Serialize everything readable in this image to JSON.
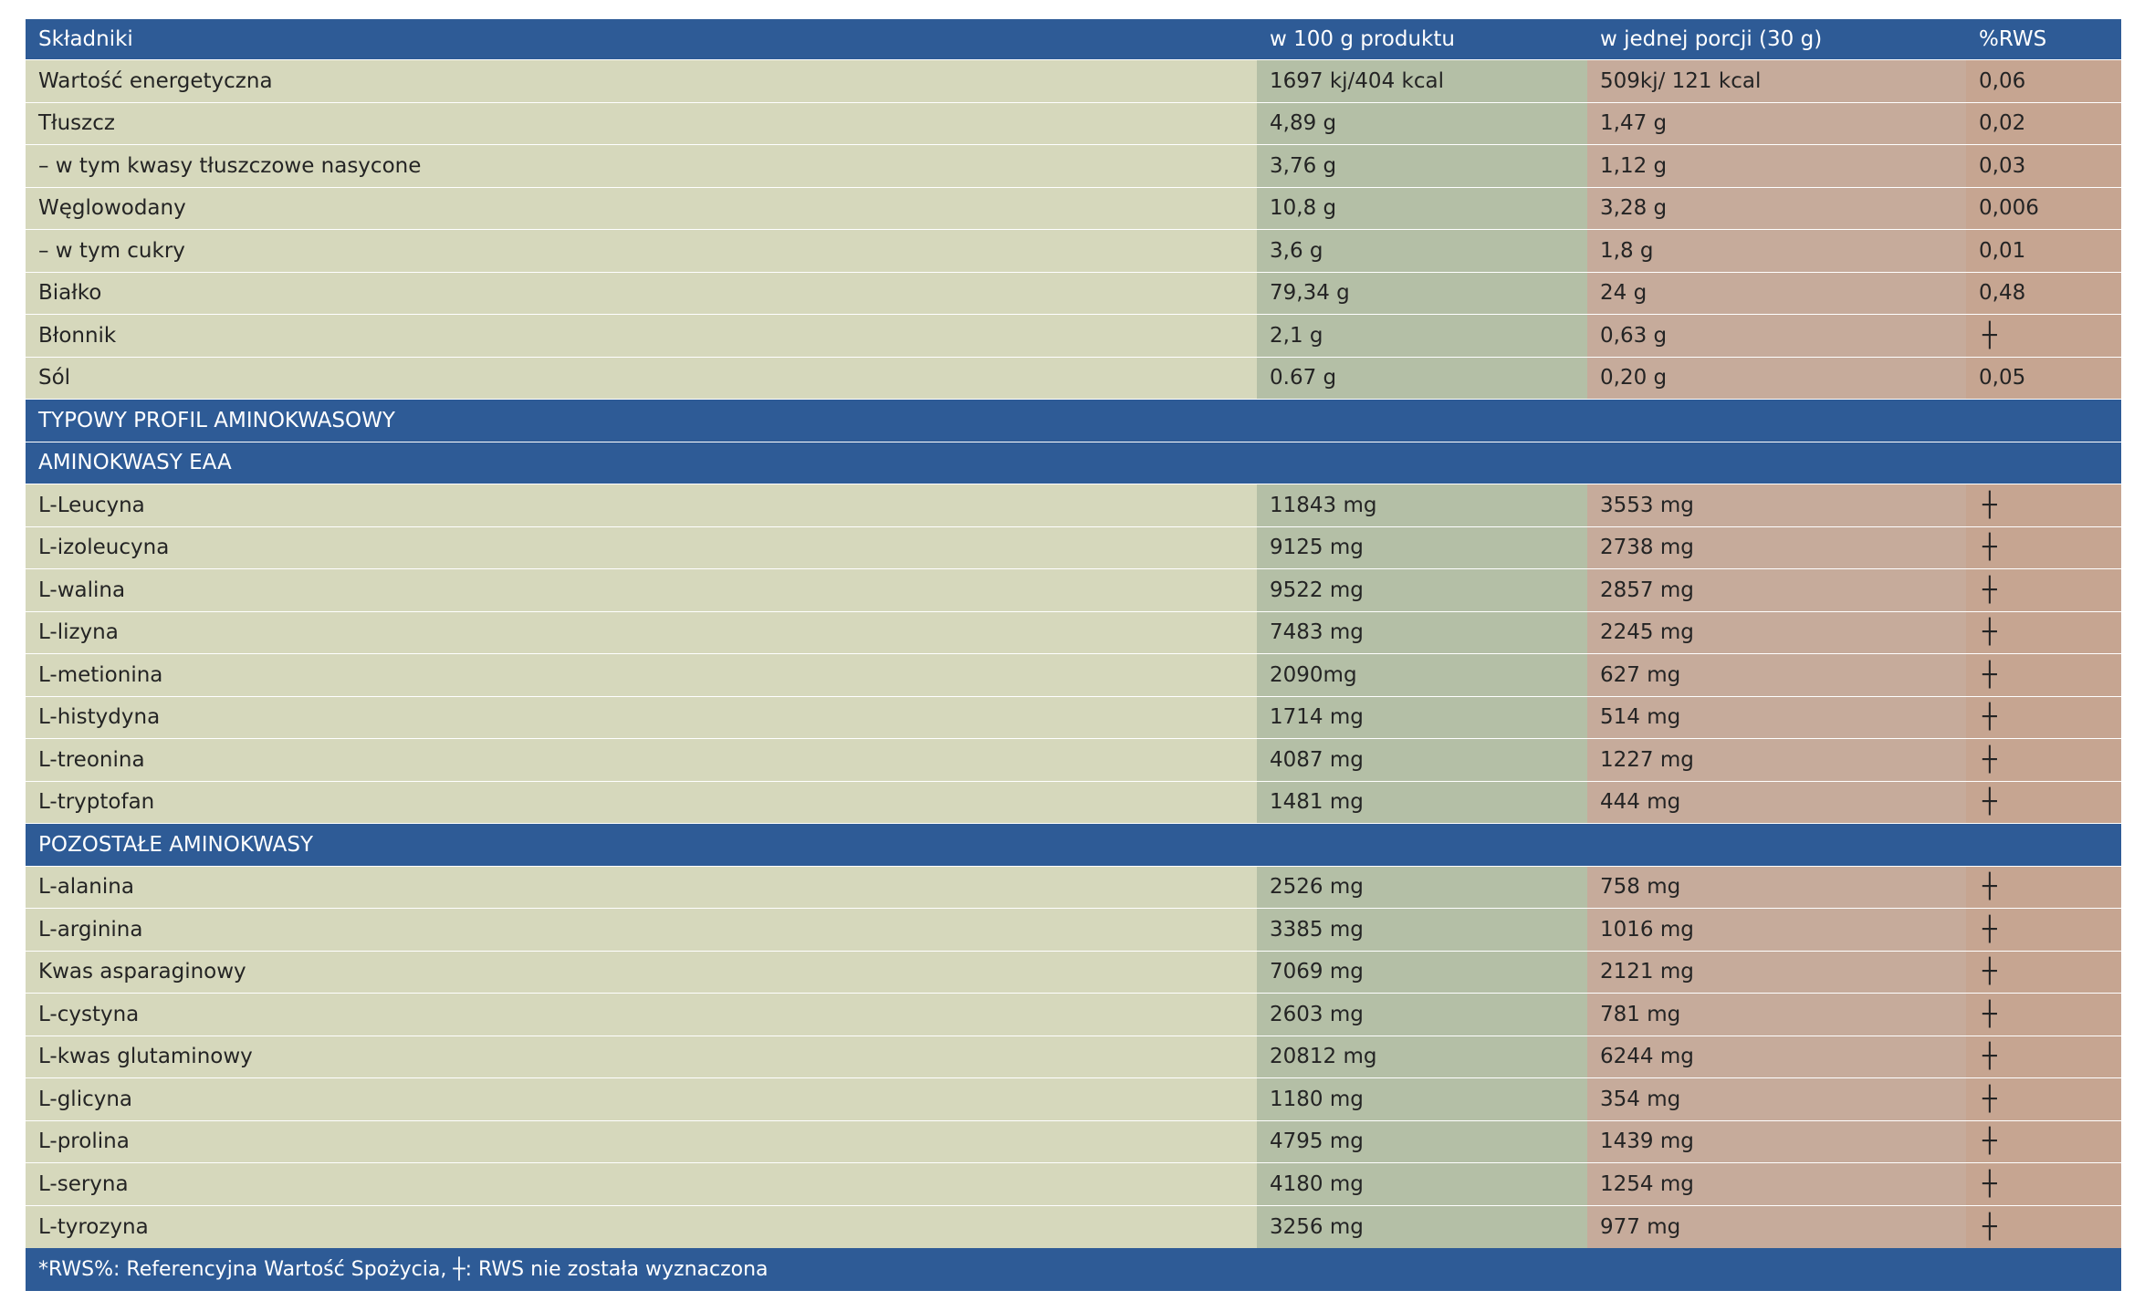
{
  "colors": {
    "header_blue": "#2e5b96",
    "col1_bg": "#d6d8bc",
    "col2_bg": "#b4bfa6",
    "col3_bg": "#c6ab9b",
    "col4_bg": "#c6a591"
  },
  "table": {
    "header": [
      "Składniki",
      "w 100 g produktu",
      "w jednej porcji (30 g)",
      "%RWS"
    ],
    "rows": [
      {
        "type": "data",
        "cells": [
          "Wartość energetyczna",
          "1697 kj/404 kcal",
          "509kj/ 121 kcal",
          "0,06"
        ]
      },
      {
        "type": "data",
        "cells": [
          "Tłuszcz",
          "4,89 g",
          "1,47 g",
          "0,02"
        ]
      },
      {
        "type": "data",
        "cells": [
          "– w tym kwasy tłuszczowe nasycone",
          "3,76 g",
          "1,12 g",
          "0,03"
        ]
      },
      {
        "type": "data",
        "cells": [
          "Węglowodany",
          "10,8 g",
          "3,28 g",
          "0,006"
        ]
      },
      {
        "type": "data",
        "cells": [
          "– w tym cukry",
          "3,6 g",
          "1,8 g",
          "0,01"
        ]
      },
      {
        "type": "data",
        "cells": [
          "Białko",
          "79,34 g",
          "24 g",
          "0,48"
        ]
      },
      {
        "type": "data",
        "cells": [
          "Błonnik",
          "2,1 g",
          "0,63 g",
          "┼"
        ]
      },
      {
        "type": "data",
        "cells": [
          "Sól",
          "0.67 g",
          "0,20 g",
          "0,05"
        ]
      },
      {
        "type": "section",
        "label": "TYPOWY PROFIL AMINOKWASOWY"
      },
      {
        "type": "section",
        "label": "AMINOKWASY EAA"
      },
      {
        "type": "data",
        "cells": [
          "L-Leucyna",
          "11843 mg",
          "3553 mg",
          "┼"
        ]
      },
      {
        "type": "data",
        "cells": [
          "L-izoleucyna",
          "9125 mg",
          "2738 mg",
          "┼"
        ]
      },
      {
        "type": "data",
        "cells": [
          "L-walina",
          "9522 mg",
          "2857 mg",
          "┼"
        ]
      },
      {
        "type": "data",
        "cells": [
          "L-lizyna",
          "7483 mg",
          "2245 mg",
          "┼"
        ]
      },
      {
        "type": "data",
        "cells": [
          "L-metionina",
          "2090mg",
          "627 mg",
          "┼"
        ]
      },
      {
        "type": "data",
        "cells": [
          "L-histydyna",
          "1714 mg",
          "514 mg",
          "┼"
        ]
      },
      {
        "type": "data",
        "cells": [
          "L-treonina",
          "4087 mg",
          "1227 mg",
          "┼"
        ]
      },
      {
        "type": "data",
        "cells": [
          "L-tryptofan",
          "1481 mg",
          "444 mg",
          "┼"
        ]
      },
      {
        "type": "section",
        "label": "POZOSTAŁE AMINOKWASY"
      },
      {
        "type": "data",
        "cells": [
          "L-alanina",
          "2526 mg",
          "758 mg",
          "┼"
        ]
      },
      {
        "type": "data",
        "cells": [
          "L-arginina",
          "3385 mg",
          "1016 mg",
          "┼"
        ]
      },
      {
        "type": "data",
        "cells": [
          "Kwas asparaginowy",
          "7069 mg",
          "2121 mg",
          "┼"
        ]
      },
      {
        "type": "data",
        "cells": [
          "L-cystyna",
          "2603 mg",
          "781 mg",
          "┼"
        ]
      },
      {
        "type": "data",
        "cells": [
          "L-kwas glutaminowy",
          "20812 mg",
          "6244 mg",
          "┼"
        ]
      },
      {
        "type": "data",
        "cells": [
          "L-glicyna",
          "1180 mg",
          "354 mg",
          "┼"
        ]
      },
      {
        "type": "data",
        "cells": [
          "L-prolina",
          "4795 mg",
          "1439 mg",
          "┼"
        ]
      },
      {
        "type": "data",
        "cells": [
          "L-seryna",
          "4180 mg",
          "1254 mg",
          "┼"
        ]
      },
      {
        "type": "data",
        "cells": [
          "L-tyrozyna",
          "3256 mg",
          "977 mg",
          "┼"
        ]
      }
    ],
    "footer": "*RWS%: Referencyjna Wartość Spożycia, ┼: RWS nie została wyznaczona"
  }
}
